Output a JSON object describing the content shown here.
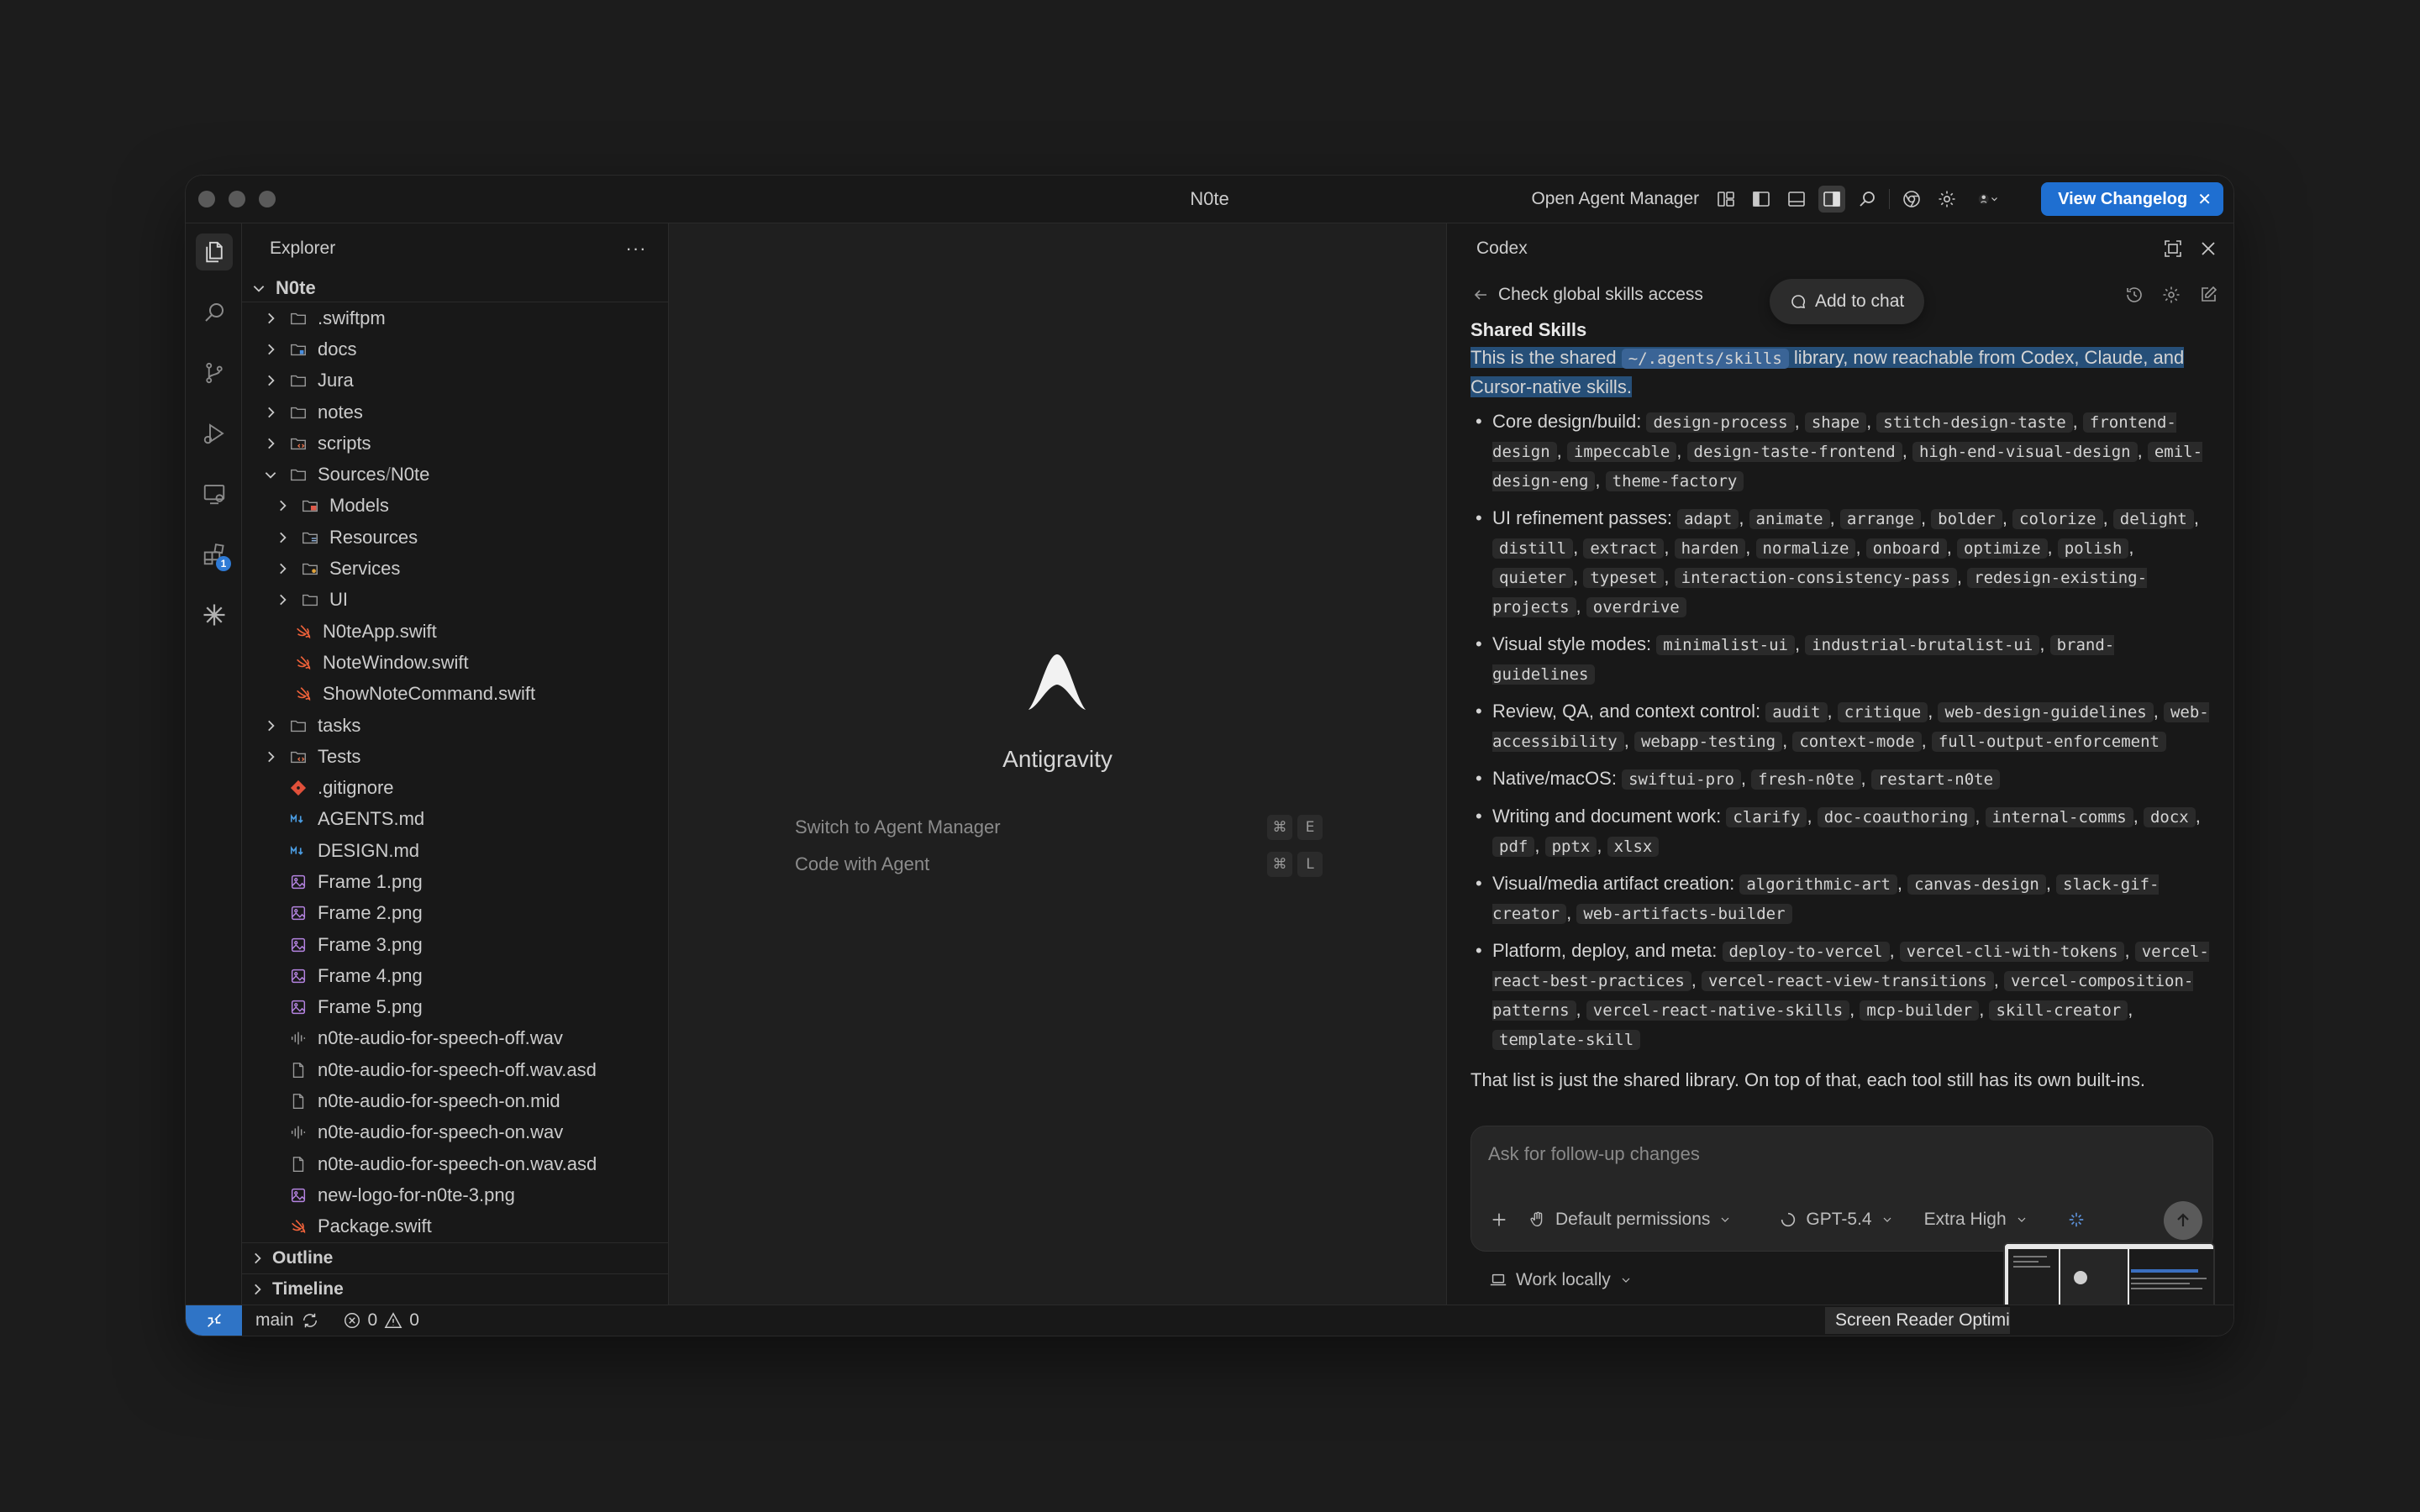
{
  "window": {
    "title": "N0te"
  },
  "titlebar": {
    "open_agent_manager": "Open Agent Manager",
    "view_changelog": "View Changelog",
    "colors": {
      "accent": "#1f6fd1"
    }
  },
  "explorer": {
    "title": "Explorer",
    "more": "···",
    "root": "N0te",
    "items": [
      {
        "label": ".swiftpm",
        "kind": "folder",
        "depth": 1,
        "chevron": "right"
      },
      {
        "label": "docs",
        "kind": "folder-docs",
        "depth": 1,
        "chevron": "right"
      },
      {
        "label": "Jura",
        "kind": "folder",
        "depth": 1,
        "chevron": "right"
      },
      {
        "label": "notes",
        "kind": "folder",
        "depth": 1,
        "chevron": "right"
      },
      {
        "label": "scripts",
        "kind": "folder-scripts",
        "depth": 1,
        "chevron": "right"
      },
      {
        "label": "Sources",
        "label2": "N0te",
        "kind": "folder",
        "depth": 1,
        "chevron": "down"
      },
      {
        "label": "Models",
        "kind": "folder-models",
        "depth": 2,
        "chevron": "right"
      },
      {
        "label": "Resources",
        "kind": "folder-resources",
        "depth": 2,
        "chevron": "right"
      },
      {
        "label": "Services",
        "kind": "folder-services",
        "depth": 2,
        "chevron": "right"
      },
      {
        "label": "UI",
        "kind": "folder",
        "depth": 2,
        "chevron": "right"
      },
      {
        "label": "N0teApp.swift",
        "kind": "swift",
        "depth": 2,
        "chevron": "none"
      },
      {
        "label": "NoteWindow.swift",
        "kind": "swift",
        "depth": 2,
        "chevron": "none"
      },
      {
        "label": "ShowNoteCommand.swift",
        "kind": "swift",
        "depth": 2,
        "chevron": "none"
      },
      {
        "label": "tasks",
        "kind": "folder",
        "depth": 1,
        "chevron": "right"
      },
      {
        "label": "Tests",
        "kind": "folder-tests",
        "depth": 1,
        "chevron": "right"
      },
      {
        "label": ".gitignore",
        "kind": "git",
        "depth": 1,
        "chevron": "none"
      },
      {
        "label": "AGENTS.md",
        "kind": "md",
        "depth": 1,
        "chevron": "none"
      },
      {
        "label": "DESIGN.md",
        "kind": "md",
        "depth": 1,
        "chevron": "none"
      },
      {
        "label": "Frame 1.png",
        "kind": "image",
        "depth": 1,
        "chevron": "none"
      },
      {
        "label": "Frame 2.png",
        "kind": "image",
        "depth": 1,
        "chevron": "none"
      },
      {
        "label": "Frame 3.png",
        "kind": "image",
        "depth": 1,
        "chevron": "none"
      },
      {
        "label": "Frame 4.png",
        "kind": "image",
        "depth": 1,
        "chevron": "none"
      },
      {
        "label": "Frame 5.png",
        "kind": "image",
        "depth": 1,
        "chevron": "none"
      },
      {
        "label": "n0te-audio-for-speech-off.wav",
        "kind": "audio",
        "depth": 1,
        "chevron": "none"
      },
      {
        "label": "n0te-audio-for-speech-off.wav.asd",
        "kind": "file",
        "depth": 1,
        "chevron": "none"
      },
      {
        "label": "n0te-audio-for-speech-on.mid",
        "kind": "file",
        "depth": 1,
        "chevron": "none"
      },
      {
        "label": "n0te-audio-for-speech-on.wav",
        "kind": "audio",
        "depth": 1,
        "chevron": "none"
      },
      {
        "label": "n0te-audio-for-speech-on.wav.asd",
        "kind": "file",
        "depth": 1,
        "chevron": "none"
      },
      {
        "label": "new-logo-for-n0te-3.png",
        "kind": "image",
        "depth": 1,
        "chevron": "none"
      },
      {
        "label": "Package.swift",
        "kind": "swift",
        "depth": 1,
        "chevron": "none"
      }
    ],
    "outline": "Outline",
    "timeline": "Timeline"
  },
  "editor": {
    "product": "Antigravity",
    "actions": [
      {
        "label": "Switch to Agent Manager",
        "keys": [
          "⌘",
          "E"
        ]
      },
      {
        "label": "Code with Agent",
        "keys": [
          "⌘",
          "L"
        ]
      }
    ]
  },
  "codex": {
    "title": "Codex",
    "thread_title": "Check global skills access",
    "add_to_chat": "Add to chat",
    "heading": "Shared Skills",
    "intro_pre": "This is the shared",
    "intro_code": "~/.agents/skills",
    "intro_post": "library, now reachable from Codex, Claude, and Cursor-native skills.",
    "groups": [
      {
        "label": "Core design/build:",
        "items": [
          "design-process",
          "shape",
          "stitch-design-taste",
          "frontend-design",
          "impeccable",
          "design-taste-frontend",
          "high-end-visual-design",
          "emil-design-eng",
          "theme-factory"
        ]
      },
      {
        "label": "UI refinement passes:",
        "items": [
          "adapt",
          "animate",
          "arrange",
          "bolder",
          "colorize",
          "delight",
          "distill",
          "extract",
          "harden",
          "normalize",
          "onboard",
          "optimize",
          "polish",
          "quieter",
          "typeset",
          "interaction-consistency-pass",
          "redesign-existing-projects",
          "overdrive"
        ]
      },
      {
        "label": "Visual style modes:",
        "items": [
          "minimalist-ui",
          "industrial-brutalist-ui",
          "brand-guidelines"
        ]
      },
      {
        "label": "Review, QA, and context control:",
        "items": [
          "audit",
          "critique",
          "web-design-guidelines",
          "web-accessibility",
          "webapp-testing",
          "context-mode",
          "full-output-enforcement"
        ]
      },
      {
        "label": "Native/macOS:",
        "items": [
          "swiftui-pro",
          "fresh-n0te",
          "restart-n0te"
        ]
      },
      {
        "label": "Writing and document work:",
        "items": [
          "clarify",
          "doc-coauthoring",
          "internal-comms",
          "docx",
          "pdf",
          "pptx",
          "xlsx"
        ]
      },
      {
        "label": "Visual/media artifact creation:",
        "items": [
          "algorithmic-art",
          "canvas-design",
          "slack-gif-creator",
          "web-artifacts-builder"
        ]
      },
      {
        "label": "Platform, deploy, and meta:",
        "items": [
          "deploy-to-vercel",
          "vercel-cli-with-tokens",
          "vercel-react-best-practices",
          "vercel-react-view-transitions",
          "vercel-composition-patterns",
          "vercel-react-native-skills",
          "mcp-builder",
          "skill-creator",
          "template-skill"
        ]
      }
    ],
    "after": "That list is just the shared library. On top of that, each tool still has its own built-ins.",
    "composer": {
      "placeholder": "Ask for follow-up changes",
      "permissions": "Default permissions",
      "model": "GPT-5.4",
      "effort": "Extra High"
    },
    "work_locally": "Work locally"
  },
  "statusbar": {
    "branch": "main",
    "errors": "0",
    "warnings": "0",
    "screen_reader": "Screen Reader Optimi"
  }
}
